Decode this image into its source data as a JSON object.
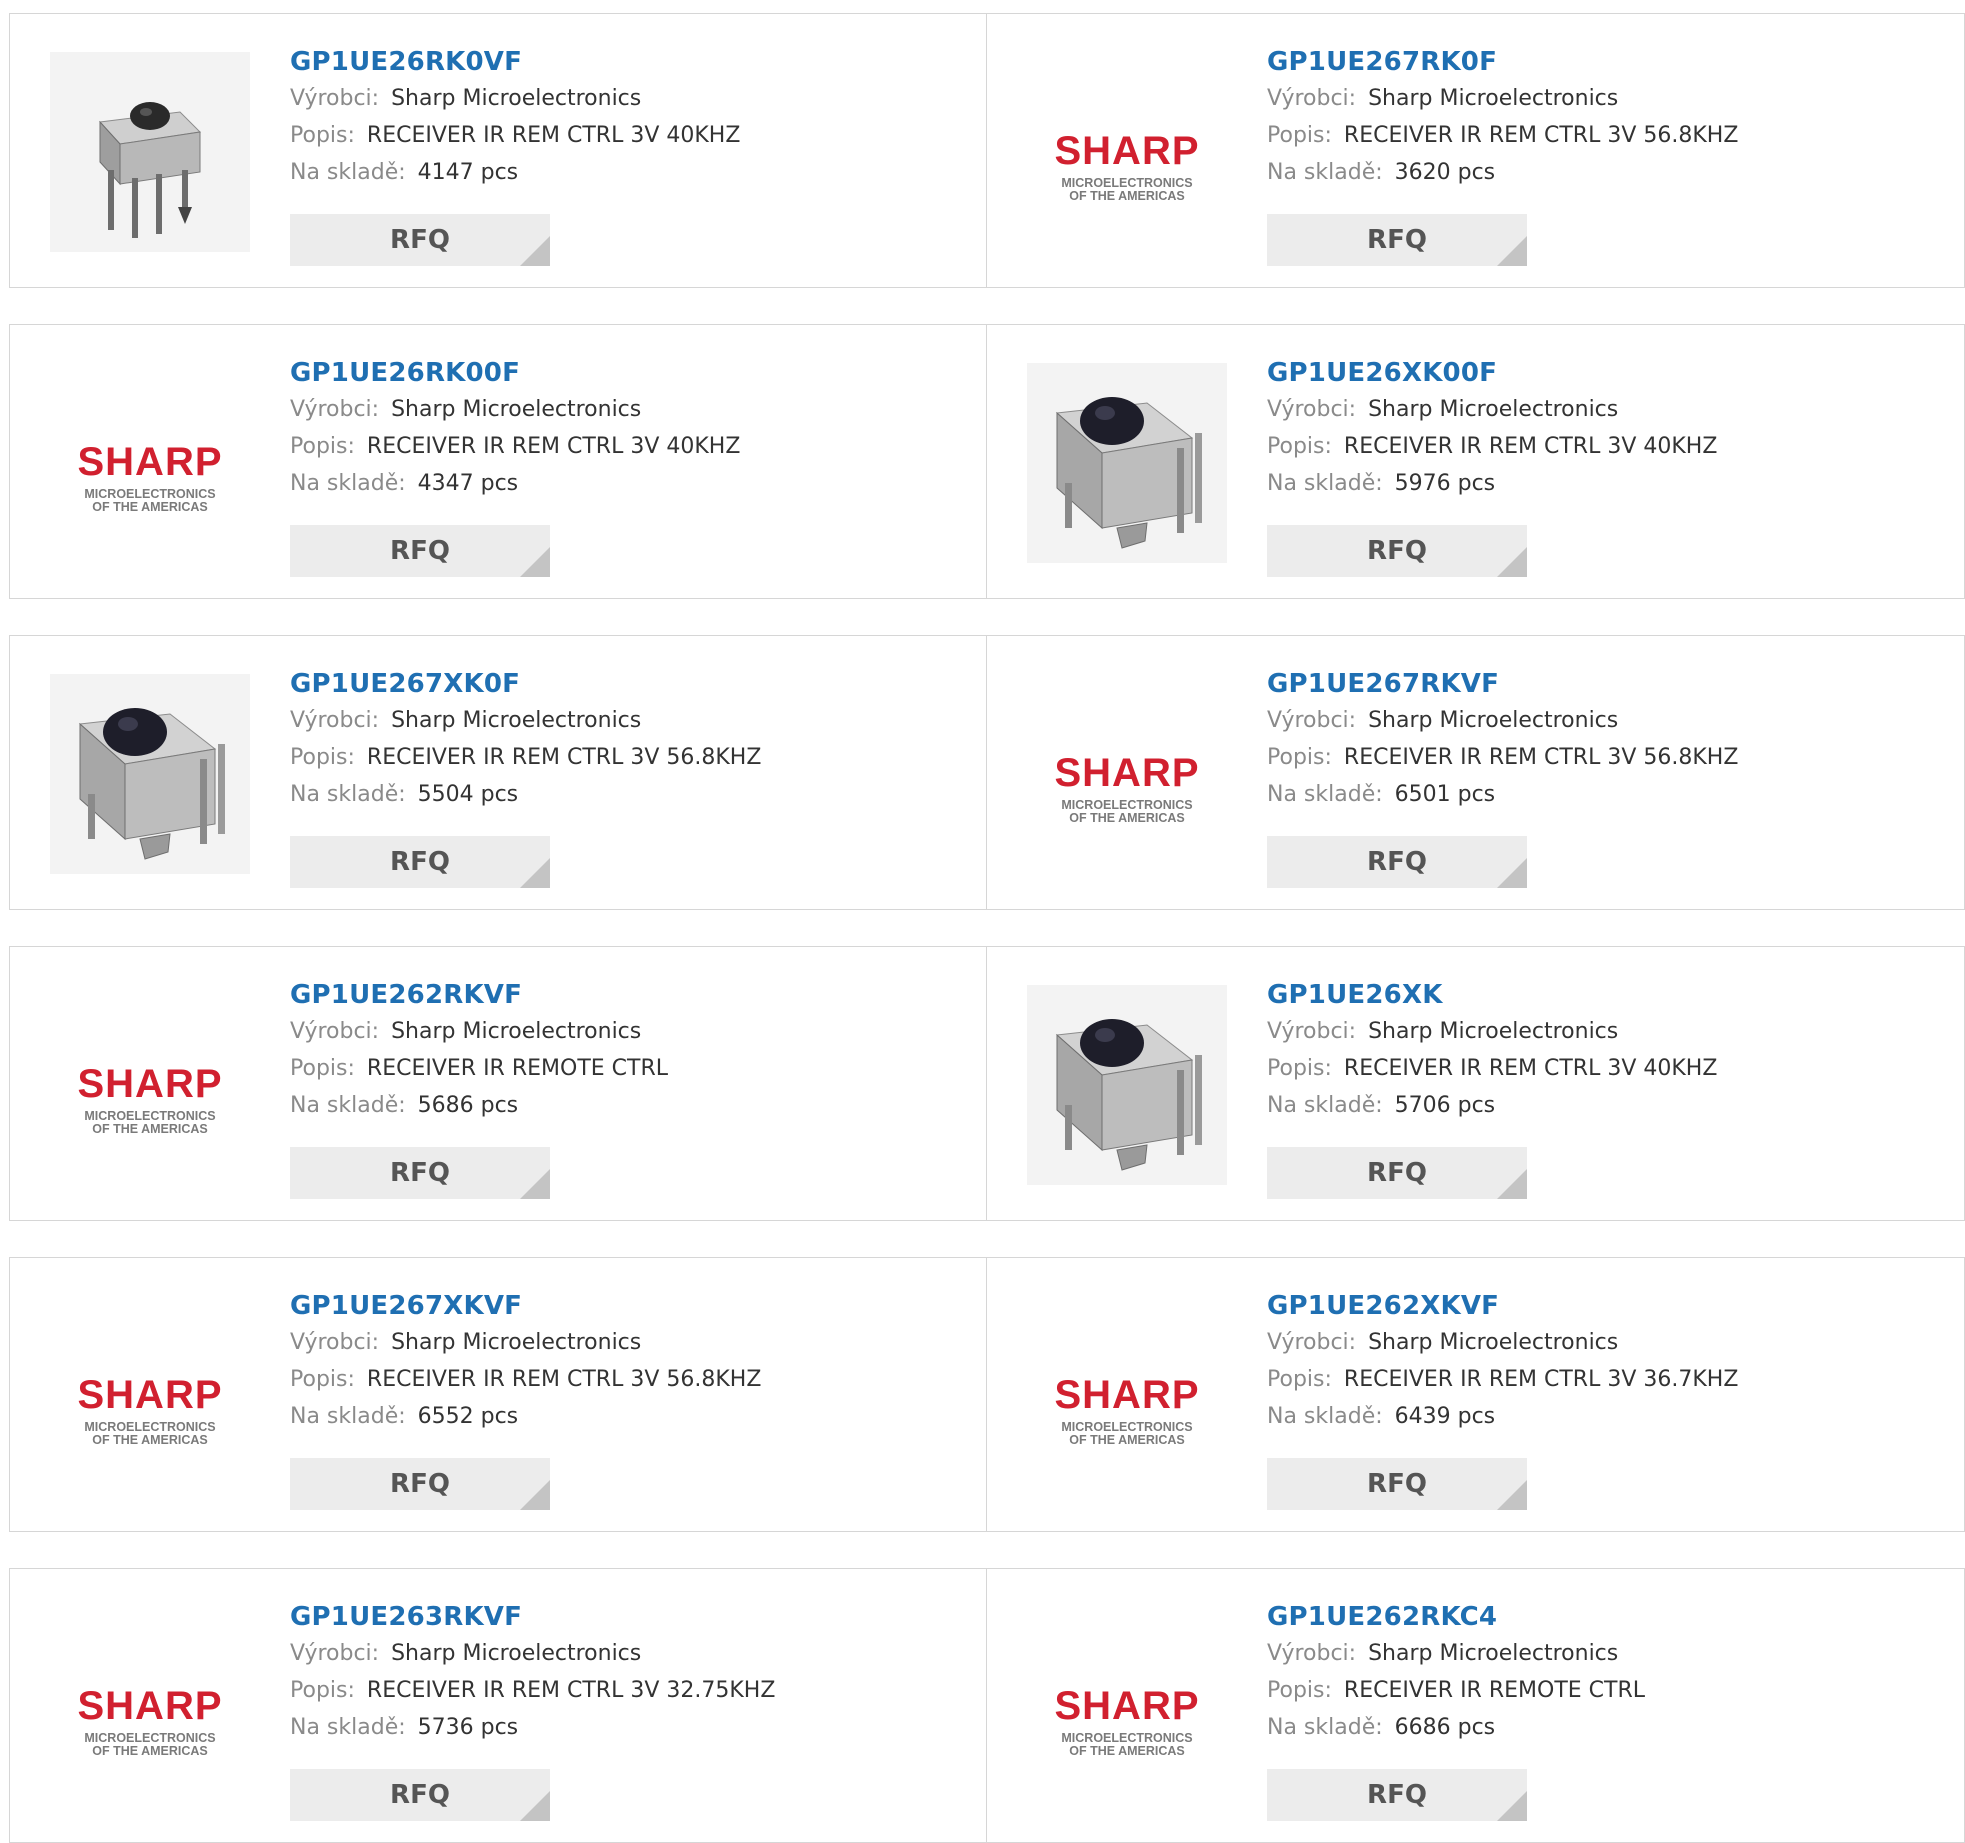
{
  "labels": {
    "manufacturer": "Výrobci:",
    "description": "Popis:",
    "stock": "Na skladě:",
    "rfq": "RFQ"
  },
  "colors": {
    "link": "#1f6fb2",
    "sharp_red": "#d1202f",
    "button_bg": "#ececec"
  },
  "products": [
    {
      "part": "GP1UE26RK0VF",
      "manufacturer": "Sharp Microelectronics",
      "description": "RECEIVER IR REM CTRL 3V 40KHZ",
      "stock": "4147 pcs",
      "image": "sensor-small"
    },
    {
      "part": "GP1UE267RK0F",
      "manufacturer": "Sharp Microelectronics",
      "description": "RECEIVER IR REM CTRL 3V 56.8KHZ",
      "stock": "3620 pcs",
      "image": "sharp-logo"
    },
    {
      "part": "GP1UE26RK00F",
      "manufacturer": "Sharp Microelectronics",
      "description": "RECEIVER IR REM CTRL 3V 40KHZ",
      "stock": "4347 pcs",
      "image": "sharp-logo"
    },
    {
      "part": "GP1UE26XK00F",
      "manufacturer": "Sharp Microelectronics",
      "description": "RECEIVER IR REM CTRL 3V 40KHZ",
      "stock": "5976 pcs",
      "image": "sensor-large"
    },
    {
      "part": "GP1UE267XK0F",
      "manufacturer": "Sharp Microelectronics",
      "description": "RECEIVER IR REM CTRL 3V 56.8KHZ",
      "stock": "5504 pcs",
      "image": "sensor-large"
    },
    {
      "part": "GP1UE267RKVF",
      "manufacturer": "Sharp Microelectronics",
      "description": "RECEIVER IR REM CTRL 3V 56.8KHZ",
      "stock": "6501 pcs",
      "image": "sharp-logo"
    },
    {
      "part": "GP1UE262RKVF",
      "manufacturer": "Sharp Microelectronics",
      "description": "RECEIVER IR REMOTE CTRL",
      "stock": "5686 pcs",
      "image": "sharp-logo"
    },
    {
      "part": "GP1UE26XK",
      "manufacturer": "Sharp Microelectronics",
      "description": "RECEIVER IR REM CTRL 3V 40KHZ",
      "stock": "5706 pcs",
      "image": "sensor-large"
    },
    {
      "part": "GP1UE267XKVF",
      "manufacturer": "Sharp Microelectronics",
      "description": "RECEIVER IR REM CTRL 3V 56.8KHZ",
      "stock": "6552 pcs",
      "image": "sharp-logo"
    },
    {
      "part": "GP1UE262XKVF",
      "manufacturer": "Sharp Microelectronics",
      "description": "RECEIVER IR REM CTRL 3V 36.7KHZ",
      "stock": "6439 pcs",
      "image": "sharp-logo"
    },
    {
      "part": "GP1UE263RKVF",
      "manufacturer": "Sharp Microelectronics",
      "description": "RECEIVER IR REM CTRL 3V 32.75KHZ",
      "stock": "5736 pcs",
      "image": "sharp-logo"
    },
    {
      "part": "GP1UE262RKC4",
      "manufacturer": "Sharp Microelectronics",
      "description": "RECEIVER IR REMOTE CTRL",
      "stock": "6686 pcs",
      "image": "sharp-logo"
    }
  ],
  "logo": {
    "brand": "SHARP",
    "line1": "MICROELECTRONICS",
    "line2": "OF THE AMERICAS"
  }
}
